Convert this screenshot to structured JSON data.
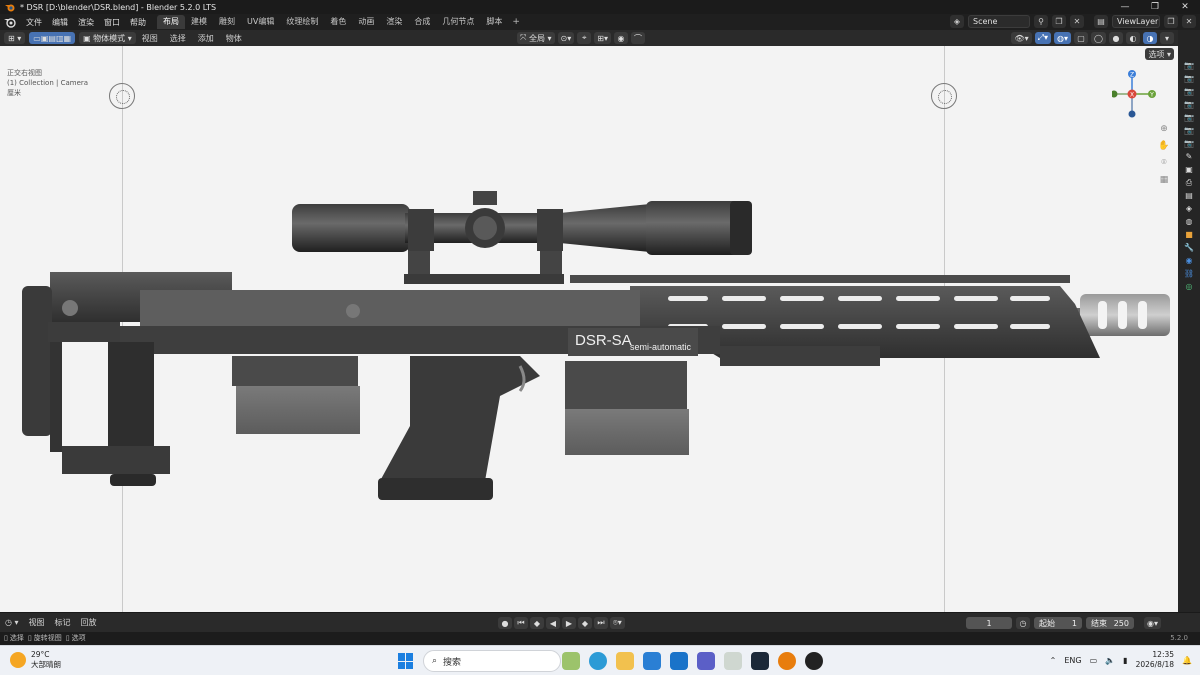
{
  "window": {
    "title": "* DSR [D:\\blender\\DSR.blend] - Blender 5.2.0 LTS",
    "controls": [
      "—",
      "❐",
      "✕"
    ]
  },
  "menu": {
    "items": [
      "文件",
      "编辑",
      "渲染",
      "窗口",
      "帮助"
    ],
    "workspaces": [
      "布局",
      "建模",
      "雕刻",
      "UV编辑",
      "纹理绘制",
      "着色",
      "动画",
      "渲染",
      "合成",
      "几何节点",
      "脚本"
    ],
    "active_workspace": "布局",
    "add_workspace": "+",
    "scene": "Scene",
    "view_layer": "ViewLayer"
  },
  "viewport_header": {
    "mode": "物体模式",
    "menus": [
      "视图",
      "选择",
      "添加",
      "物体"
    ],
    "transform_orientation": "全局",
    "select_button": "选项"
  },
  "viewport": {
    "info_lines": [
      "正交右视图",
      "(1) Collection | Camera",
      "厘米"
    ],
    "gizmo_axes": {
      "z": "Z",
      "x": "X",
      "y": "Y"
    },
    "colors": {
      "background": "#f3f3f3",
      "gun_body": "#3f3f3f",
      "gizmo_x": "#d9473b",
      "gizmo_y": "#6aa23a",
      "gizmo_z": "#3b7ed9"
    },
    "model_text": {
      "brand": "DSR-SA",
      "sub": "semi-automatic"
    }
  },
  "timeline": {
    "menus": [
      "视图",
      "标记",
      "回放"
    ],
    "current_frame": "1",
    "start_label": "起始",
    "start": "1",
    "end_label": "结束",
    "end": "250"
  },
  "statusbar": {
    "items": [
      "选择",
      "旋转视图",
      "选项"
    ],
    "version": "5.2.0"
  },
  "taskbar": {
    "weather_temp": "29°C",
    "weather_desc": "大部晴朗",
    "search_placeholder": "搜索",
    "language": "ENG",
    "time": "12:35",
    "date": "2026/8/18"
  }
}
